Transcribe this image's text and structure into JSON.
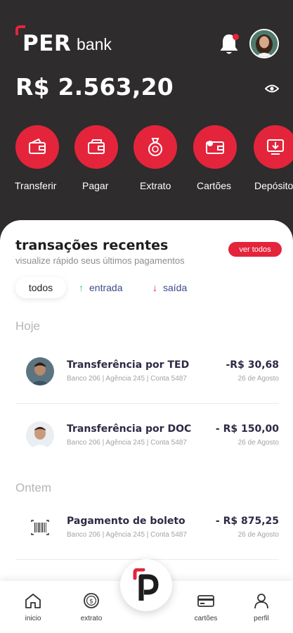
{
  "brand": {
    "name_bold": "PER",
    "name_light": "bank",
    "accent": "#e4243b",
    "dark": "#2e2c2d"
  },
  "header": {
    "balance": "R$ 2.563,20",
    "notification_icon": "bell-icon",
    "visibility_icon": "eye-icon"
  },
  "actions": [
    {
      "label": "Transferir",
      "icon": "wallet-transfer-icon"
    },
    {
      "label": "Pagar",
      "icon": "wallet-pay-icon"
    },
    {
      "label": "Extrato",
      "icon": "money-bag-icon"
    },
    {
      "label": "Cartões",
      "icon": "card-wallet-icon"
    },
    {
      "label": "Depósito",
      "icon": "deposit-icon"
    }
  ],
  "recent": {
    "title": "transações recentes",
    "subtitle": "visualize rápido seus últimos pagamentos",
    "see_all": "ver todos",
    "filters": {
      "all": "todos",
      "in": "entrada",
      "out": "saída"
    }
  },
  "groups": [
    {
      "day": "Hoje",
      "items": [
        {
          "title": "Transferência por TED",
          "meta": "Banco 206 | Agência 245 | Conta 5487",
          "amount": "-R$ 30,68",
          "date": "26 de Agosto"
        },
        {
          "title": "Transferência por DOC",
          "meta": "Banco 206 | Agência 245 | Conta 5487",
          "amount": "- R$ 150,00",
          "date": "26 de Agosto"
        }
      ]
    },
    {
      "day": "Ontem",
      "items": [
        {
          "title": "Pagamento de boleto",
          "meta": "Banco 206 | Agência 245 | Conta 5487",
          "amount": "- R$ 875,25",
          "date": "26 de Agosto"
        }
      ]
    }
  ],
  "nav": {
    "home": "inicio",
    "statement": "extrato",
    "cards": "cartões",
    "profile": "perfil"
  }
}
